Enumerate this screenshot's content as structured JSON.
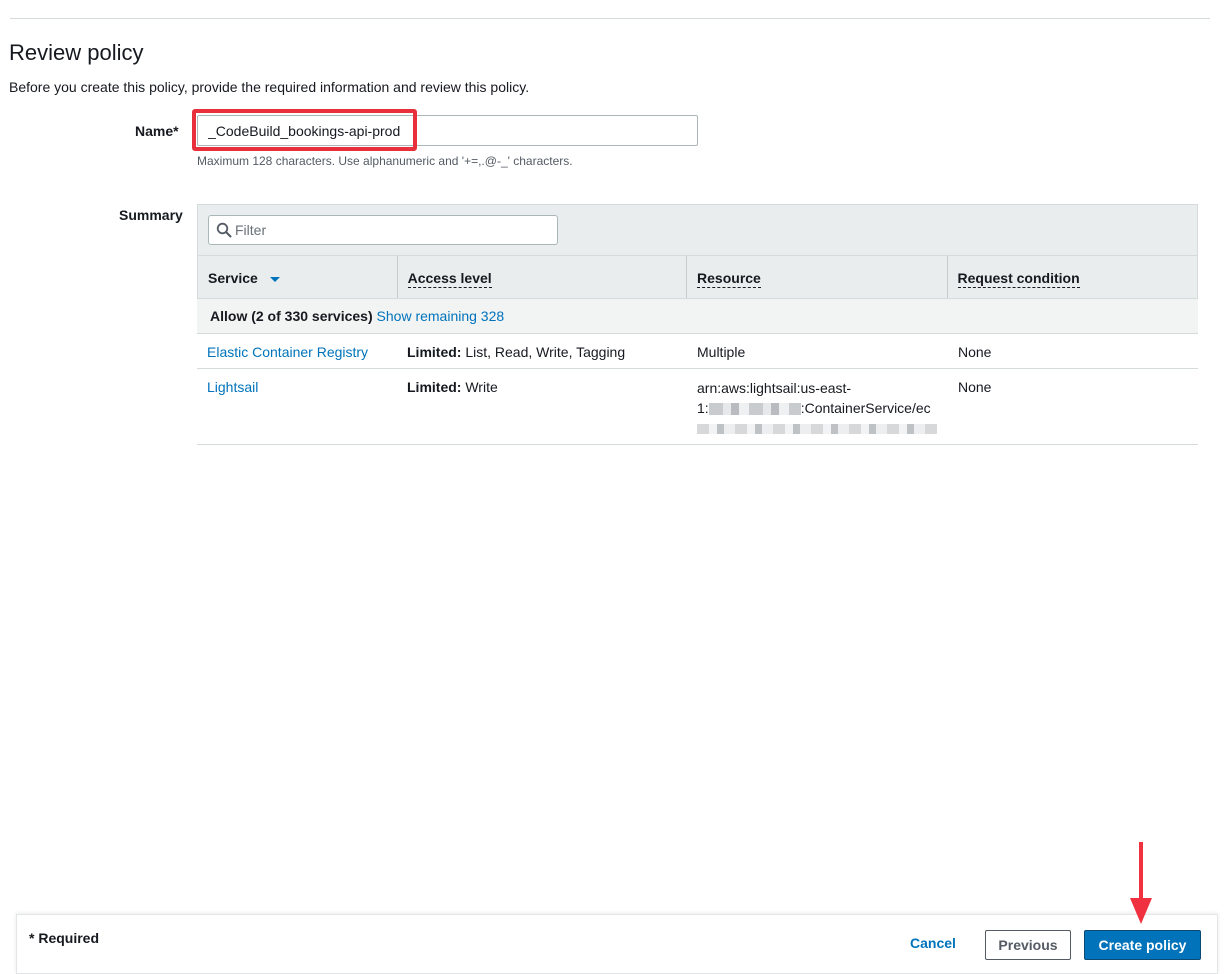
{
  "page": {
    "title": "Review policy",
    "description": "Before you create this policy, provide the required information and review this policy."
  },
  "name_field": {
    "label": "Name*",
    "value": "_CodeBuild_bookings-api-prod",
    "hint": "Maximum 128 characters. Use alphanumeric and '+=,.@-_' characters."
  },
  "summary": {
    "label": "Summary",
    "filter_placeholder": "Filter",
    "columns": [
      "Service",
      "Access level",
      "Resource",
      "Request condition"
    ],
    "group": {
      "label": "Allow (2 of 330 services)",
      "link": "Show remaining 328"
    },
    "rows": [
      {
        "service": "Elastic Container Registry",
        "access_prefix": "Limited:",
        "access_rest": "List, Read, Write, Tagging",
        "resource_line1": "Multiple",
        "resource_line2_prefix": "",
        "resource_line2_suffix": "",
        "condition": "None"
      },
      {
        "service": "Lightsail",
        "access_prefix": "Limited:",
        "access_rest": "Write",
        "resource_line1": "arn:aws:lightsail:us-east-",
        "resource_line2_prefix": "1:",
        "resource_line2_suffix": ":ContainerService/ec",
        "condition": "None"
      }
    ]
  },
  "footer": {
    "required_note": "* Required",
    "cancel": "Cancel",
    "previous": "Previous",
    "create": "Create policy"
  },
  "colors": {
    "link": "#0073bb",
    "primary_button": "#0073bb",
    "highlight": "#e8303d"
  }
}
